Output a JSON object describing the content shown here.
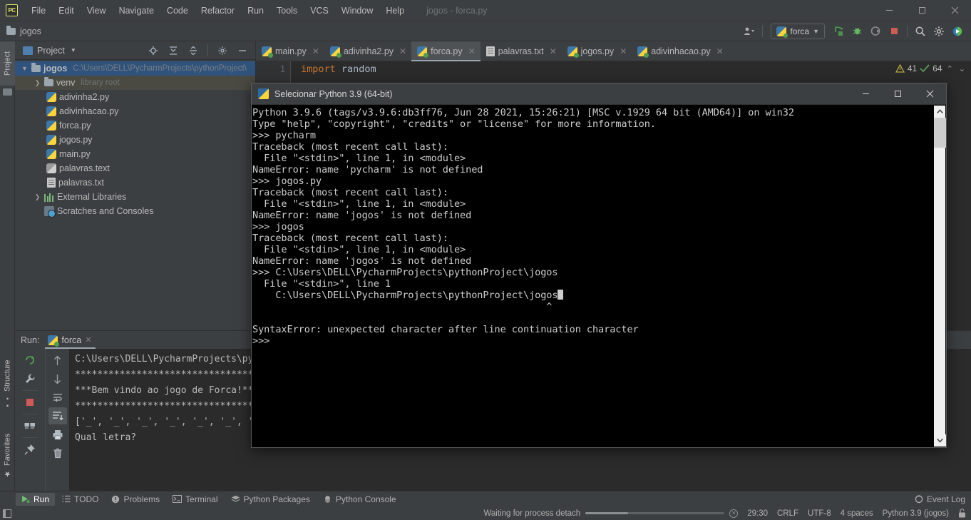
{
  "titlebar": {
    "logo": "PC",
    "menu": [
      "File",
      "Edit",
      "View",
      "Navigate",
      "Code",
      "Refactor",
      "Run",
      "Tools",
      "VCS",
      "Window",
      "Help"
    ],
    "project_title": "jogos - forca.py",
    "window_controls": {
      "minimize": "—",
      "maximize": "❐",
      "close": "✕"
    }
  },
  "navbar": {
    "breadcrumb": "jogos",
    "run_config": "forca",
    "icons": [
      "user-avatar-icon",
      "run-icon",
      "debug-icon",
      "coverage-icon",
      "stop-icon",
      "search-icon",
      "settings-icon",
      "updates-icon"
    ]
  },
  "left_tool_strip": {
    "top_tabs": [
      "Project"
    ],
    "bottom_tabs": [
      "Structure",
      "Favorites"
    ]
  },
  "project_panel": {
    "title": "Project",
    "header_icons": [
      "locate-icon",
      "expand-all-icon",
      "collapse-all-icon",
      "settings-icon",
      "hide-icon"
    ],
    "tree": [
      {
        "label": "jogos",
        "detail": "C:\\Users\\DELL\\PycharmProjects\\pythonProject\\",
        "icon": "folder-icon",
        "arrow": "▼",
        "depth": 0,
        "state": "selected"
      },
      {
        "label": "venv",
        "detail": "library root",
        "icon": "folder-icon",
        "arrow": "❯",
        "depth": 1,
        "state": "hovered"
      },
      {
        "label": "adivinha2.py",
        "detail": "",
        "icon": "python-file-icon",
        "arrow": "",
        "depth": 2,
        "state": ""
      },
      {
        "label": "adivinhacao.py",
        "detail": "",
        "icon": "python-file-icon",
        "arrow": "",
        "depth": 2,
        "state": ""
      },
      {
        "label": "forca.py",
        "detail": "",
        "icon": "python-file-icon",
        "arrow": "",
        "depth": 2,
        "state": ""
      },
      {
        "label": "jogos.py",
        "detail": "",
        "icon": "python-file-icon",
        "arrow": "",
        "depth": 2,
        "state": ""
      },
      {
        "label": "main.py",
        "detail": "",
        "icon": "python-file-icon",
        "arrow": "",
        "depth": 2,
        "state": ""
      },
      {
        "label": "palavras.text",
        "detail": "",
        "icon": "unknown-file-icon",
        "arrow": "",
        "depth": 2,
        "state": ""
      },
      {
        "label": "palavras.txt",
        "detail": "",
        "icon": "text-file-icon",
        "arrow": "",
        "depth": 2,
        "state": ""
      },
      {
        "label": "External Libraries",
        "detail": "",
        "icon": "library-icon",
        "arrow": "❯",
        "depth": 1,
        "state": ""
      },
      {
        "label": "Scratches and Consoles",
        "detail": "",
        "icon": "scratches-icon",
        "arrow": "",
        "depth": 1,
        "state": ""
      }
    ]
  },
  "editor": {
    "tabs": [
      {
        "label": "main.py",
        "icon": "python-file-icon",
        "active": false
      },
      {
        "label": "adivinha2.py",
        "icon": "python-file-icon",
        "active": false
      },
      {
        "label": "forca.py",
        "icon": "python-file-icon",
        "active": true
      },
      {
        "label": "palavras.txt",
        "icon": "text-file-icon",
        "active": false
      },
      {
        "label": "jogos.py",
        "icon": "python-file-icon",
        "active": false
      },
      {
        "label": "adivinhacao.py",
        "icon": "python-file-icon",
        "active": false
      }
    ],
    "line_number": "1",
    "code_keyword": "import",
    "code_rest": " random",
    "inspection": {
      "warning_count": "41",
      "ok_count": "64",
      "up_chevron": "⌃",
      "down_chevron": "⌄"
    }
  },
  "console_window": {
    "title": "Selecionar Python 3.9 (64-bit)",
    "icon": "python-console-icon",
    "controls": {
      "minimize": "—",
      "maximize": "❐",
      "close": "✕"
    },
    "lines": [
      "Python 3.9.6 (tags/v3.9.6:db3ff76, Jun 28 2021, 15:26:21) [MSC v.1929 64 bit (AMD64)] on win32",
      "Type \"help\", \"copyright\", \"credits\" or \"license\" for more information.",
      ">>> pycharm",
      "Traceback (most recent call last):",
      "  File \"<stdin>\", line 1, in <module>",
      "NameError: name 'pycharm' is not defined",
      ">>> jogos.py",
      "Traceback (most recent call last):",
      "  File \"<stdin>\", line 1, in <module>",
      "NameError: name 'jogos' is not defined",
      ">>> jogos",
      "Traceback (most recent call last):",
      "  File \"<stdin>\", line 1, in <module>",
      "NameError: name 'jogos' is not defined",
      ">>> C:\\Users\\DELL\\PycharmProjects\\pythonProject\\jogos",
      "  File \"<stdin>\", line 1",
      "    C:\\Users\\DELL\\PycharmProjects\\pythonProject\\jogos",
      "                                                   ^",
      "",
      "SyntaxError: unexpected character after line continuation character",
      ">>> "
    ],
    "cursor_line_index": 16,
    "scrollbar": {
      "up_arrow": "⌃",
      "down_arrow": "⌄"
    }
  },
  "run_panel": {
    "label": "Run:",
    "tab_label": "forca",
    "tab_close": "✕",
    "toolbar_left": [
      "rerun-icon",
      "settings-wrench-icon",
      "stop-icon",
      "layout-icon",
      "pin-icon"
    ],
    "toolbar_right": [
      "up-arrow-icon",
      "down-arrow-icon",
      "soft-wrap-icon",
      "scroll-to-end-icon",
      "print-icon",
      "trash-icon"
    ],
    "output": [
      "C:\\Users\\DELL\\PycharmProjects\\pyt",
      "**********************************",
      "***Bem vindo ao jogo de Forca!***",
      "**********************************",
      "['_', '_', '_', '_', '_', '_', '_",
      "Qual letra?"
    ]
  },
  "bottom_bar": {
    "items": [
      {
        "label": "Run",
        "icon": "run-triangle-icon",
        "selected": true
      },
      {
        "label": "TODO",
        "icon": "todo-list-icon",
        "selected": false
      },
      {
        "label": "Problems",
        "icon": "problems-icon",
        "selected": false
      },
      {
        "label": "Terminal",
        "icon": "terminal-icon",
        "selected": false
      },
      {
        "label": "Python Packages",
        "icon": "packages-icon",
        "selected": false
      },
      {
        "label": "Python Console",
        "icon": "python-console-icon",
        "selected": false
      }
    ],
    "event_log": {
      "label": "Event Log",
      "icon": "event-log-icon"
    }
  },
  "status_bar": {
    "process_text": "Waiting for process detach",
    "cancel_icon": "cancel-icon",
    "position": "29:30",
    "line_separator": "CRLF",
    "encoding": "UTF-8",
    "indent": "4 spaces",
    "interpreter": "Python 3.9 (jogos)",
    "lock_icon": "unlock-icon"
  },
  "colors": {
    "ide_bg": "#3c3f41",
    "editor_bg": "#2b2b2b",
    "console_bg": "#000000",
    "selection_blue": "#2f537d",
    "keyword_orange": "#cc7832",
    "accent_yellow": "#ffd43b"
  }
}
